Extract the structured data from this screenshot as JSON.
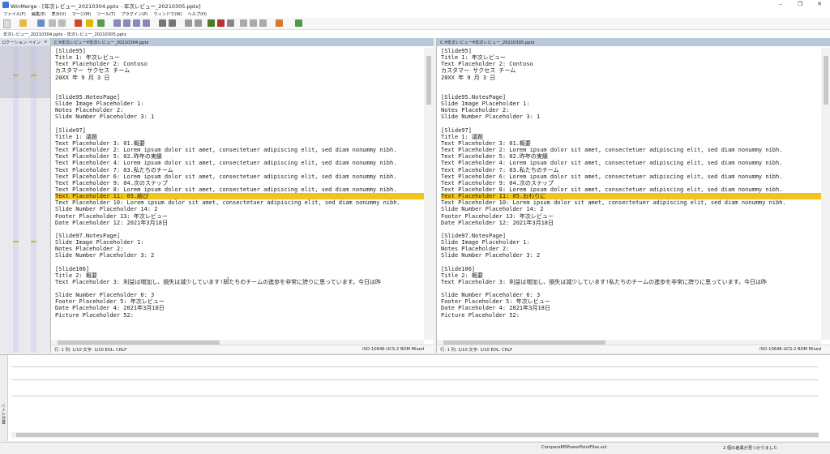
{
  "window": {
    "title": "WinMerge - [年次レビュー_20210304.pptx - 年次レビュー_20210305.pptx]"
  },
  "menu": [
    "ファイル(F)",
    "編集(E)",
    "表示(V)",
    "マージ(M)",
    "ツール(T)",
    "プラグイン(P)",
    "ウィンドウ(W)",
    "ヘルプ(H)"
  ],
  "doc_tab": "年次レビュー_20210304.pptx - 年次レビュー_20210305.pptx",
  "location_pane": {
    "title": "ロケーション ペイン",
    "close": "×"
  },
  "left": {
    "path": "C:¥年次レビュー¥年次レビュー_20210304.pptx",
    "lines": [
      "[Slide95]",
      "Title 1: 年次レビュー",
      "Text Placeholder 2: Contoso",
      "カスタマー サクセス チーム",
      "20XX 年 9 月 3 日",
      "",
      "",
      "[Slide95.NotesPage]",
      "Slide Image Placeholder 1:",
      "Notes Placeholder 2:",
      "Slide Number Placeholder 3: 1",
      "",
      "[Slide97]",
      "Title 1: 議題",
      "Text Placeholder 3: 01.概要",
      "Text Placeholder 2: Lorem ipsum dolor sit amet, consectetuer adipiscing elit, sed diam nonummy nibh.",
      "Text Placeholder 5: 02.昨年の実績",
      "Text Placeholder 4: Lorem ipsum dolor sit amet, consectetuer adipiscing elit, sed diam nonummy nibh.",
      "Text Placeholder 7: 03.私たちのチーム",
      "Text Placeholder 6: Lorem ipsum dolor sit amet, consectetuer adipiscing elit, sed diam nonummy nibh.",
      "Text Placeholder 9: 04.次のステップ",
      "Text Placeholder 8: Lorem ipsum dolor sit amet, consectetuer adipiscing elit, sed diam nonummy nibh.",
      "Text Placeholder 11: 05.結び",
      "Text Placeholder 10: Lorem ipsum dolor sit amet, consectetuer adipiscing elit, sed diam nonummy nibh.",
      "Slide Number Placeholder 14: 2",
      "Footer Placeholder 13: 年次レビュー",
      "Date Placeholder 12: 2021年3月18日",
      "",
      "[Slide97.NotesPage]",
      "Slide Image Placeholder 1:",
      "Notes Placeholder 2:",
      "Slide Number Placeholder 3: 2",
      "",
      "[Slide106]",
      "Title 2: 概要",
      "Text Placeholder 3: 利益は増加し、損失は減少しています!私たちのチームの進歩を非常に誇りに思っています。今日は昨",
      "",
      "Slide Number Placeholder 6: 3",
      "Footer Placeholder 5: 年次レビュー",
      "Date Placeholder 4: 2021年3月18日",
      "Picture Placeholder 52:"
    ],
    "highlight_line": 22,
    "status_left": "行: 1  列: 1/10  文字: 1/10  EOL: CRLF",
    "status_right": "ISO-10646-UCS-2 BOM Mixed"
  },
  "right": {
    "path": "C:¥年次レビュー¥年次レビュー_20210305.pptx",
    "lines": [
      "[Slide95]",
      "Title 1: 年次レビュー",
      "Text Placeholder 2: Contoso",
      "カスタマー サクセス チーム",
      "20XX 年 9 月 3 日",
      "",
      "",
      "[Slide95.NotesPage]",
      "Slide Image Placeholder 1:",
      "Notes Placeholder 2:",
      "Slide Number Placeholder 3: 1",
      "",
      "[Slide97]",
      "Title 1: 議題",
      "Text Placeholder 3: 01.概要",
      "Text Placeholder 2: Lorem ipsum dolor sit amet, consectetuer adipiscing elit, sed diam nonummy nibh.",
      "Text Placeholder 5: 02.昨年の実績",
      "Text Placeholder 4: Lorem ipsum dolor sit amet, consectetuer adipiscing elit, sed diam nonummy nibh.",
      "Text Placeholder 7: 03.私たちのチーム",
      "Text Placeholder 6: Lorem ipsum dolor sit amet, consectetuer adipiscing elit, sed diam nonummy nibh.",
      "Text Placeholder 9: 04.次のステップ",
      "Text Placeholder 8: Lorem ipsum dolor sit amet, consectetuer adipiscing elit, sed diam nonummy nibh.",
      "Text Placeholder 11: 05.おわりに",
      "Text Placeholder 10: Lorem ipsum dolor sit amet, consectetuer adipiscing elit, sed diam nonummy nibh.",
      "Slide Number Placeholder 14: 2",
      "Footer Placeholder 13: 年次レビュー",
      "Date Placeholder 12: 2021年3月18日",
      "",
      "[Slide97.NotesPage]",
      "Slide Image Placeholder 1:",
      "Notes Placeholder 2:",
      "Slide Number Placeholder 3: 2",
      "",
      "[Slide106]",
      "Title 2: 概要",
      "Text Placeholder 3: 利益は増加し、損失は減少しています!私たちのチームの進歩を非常に誇りに思っています。今日は昨",
      "",
      "Slide Number Placeholder 6: 3",
      "Footer Placeholder 5: 年次レビュー",
      "Date Placeholder 4: 2021年3月18日",
      "Picture Placeholder 52:"
    ],
    "highlight_line": 22,
    "status_left": "行: 1  列: 1/10  文字: 1/10  EOL: CRLF",
    "status_right": "ISO-10646-UCS-2 BOM Mixed"
  },
  "diff_pane": {
    "side_label": "差分ペイン"
  },
  "statusbar": {
    "center": "CompareMSPowerPointFiles.sct",
    "right": "2 個の差異が見つかりました"
  },
  "colors": {
    "highlight": "#f0c419",
    "pane_header": "#b9c9dc",
    "location_bar": "#dcdcf0"
  }
}
